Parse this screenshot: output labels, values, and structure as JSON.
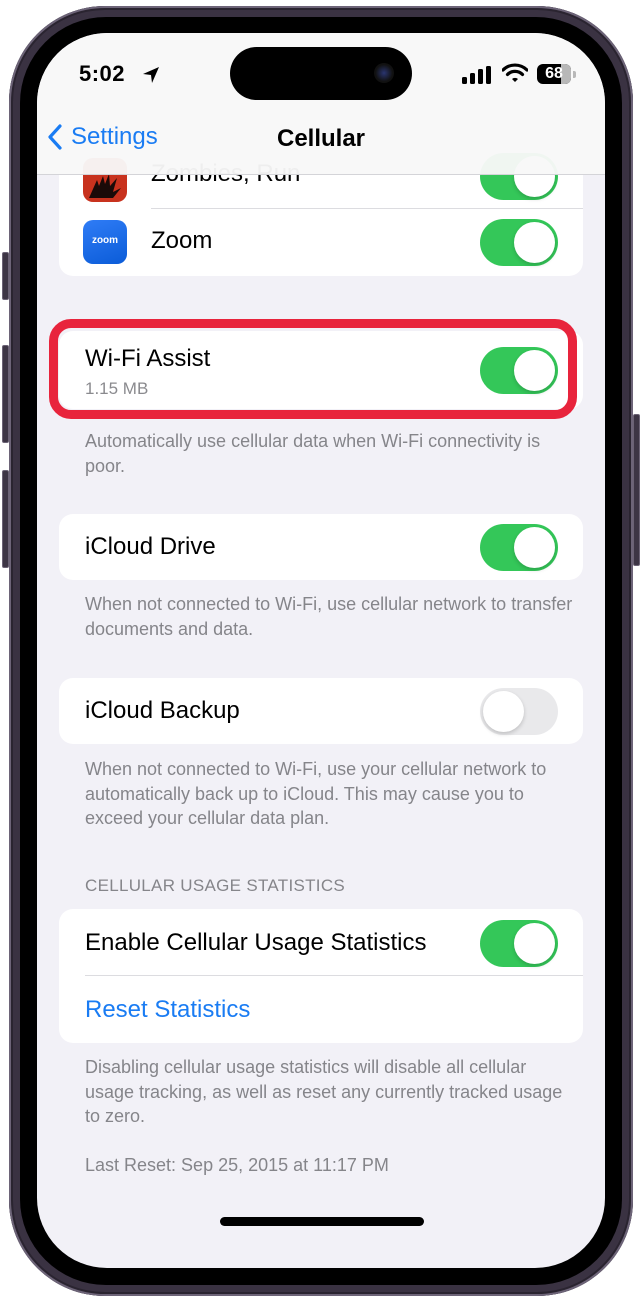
{
  "status_bar": {
    "time": "5:02",
    "battery": "68",
    "icons": [
      "location-arrow-icon",
      "cellular-signal-icon",
      "wifi-icon",
      "battery-icon"
    ]
  },
  "nav": {
    "back_label": "Settings",
    "back_icon": "chevron-left-icon",
    "title": "Cellular"
  },
  "apps": [
    {
      "name": "Zombies, Run",
      "icon": "zombies-run-app-icon",
      "enabled": true
    },
    {
      "name": "Zoom",
      "icon": "zoom-app-icon",
      "icon_text": "zoom",
      "enabled": true
    }
  ],
  "wifi_assist": {
    "label": "Wi-Fi Assist",
    "usage": "1.15 MB",
    "enabled": true,
    "footnote": "Automatically use cellular data when Wi-Fi connectivity is poor.",
    "highlight_color": "#e8243c"
  },
  "icloud_drive": {
    "label": "iCloud Drive",
    "enabled": true,
    "footnote": "When not connected to Wi-Fi, use cellular network to transfer documents and data."
  },
  "icloud_backup": {
    "label": "iCloud Backup",
    "enabled": false,
    "footnote": "When not connected to Wi-Fi, use your cellular network to automatically back up to iCloud. This may cause you to exceed your cellular data plan."
  },
  "usage_stats": {
    "section_header": "CELLULAR USAGE STATISTICS",
    "enable_label": "Enable Cellular Usage Statistics",
    "enabled": true,
    "reset_label": "Reset Statistics",
    "footnote": "Disabling cellular usage statistics will disable all cellular usage tracking, as well as reset any currently tracked usage to zero.",
    "last_reset": "Last Reset: Sep 25, 2015 at 11:17 PM"
  },
  "colors": {
    "accent": "#1a7cf3",
    "toggle_on": "#34c759",
    "toggle_off": "#e9e9eb",
    "background": "#f2f1f7"
  }
}
